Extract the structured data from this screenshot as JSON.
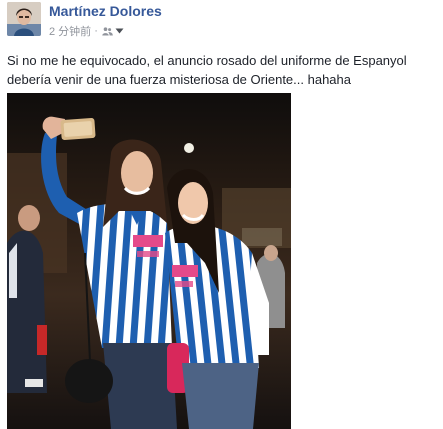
{
  "post": {
    "author_name": "Martínez Dolores",
    "timestamp": "2 分钟前",
    "separator": "·",
    "audience_icon": "friends-icon",
    "audience_dropdown_icon": "caret-down-icon",
    "text": "Si no me he equivocado, el anuncio rosado del uniforme de Espanyol debería venir de una fuerza misteriosa de Oriente... hahaha"
  },
  "photo": {
    "kit_colors": {
      "blue": "#1e5fb0",
      "white": "#ffffff",
      "pink_sponsor": "#e44a8a"
    }
  },
  "colors": {
    "name": "#365899",
    "meta": "#90949c",
    "text": "#1d2129"
  }
}
